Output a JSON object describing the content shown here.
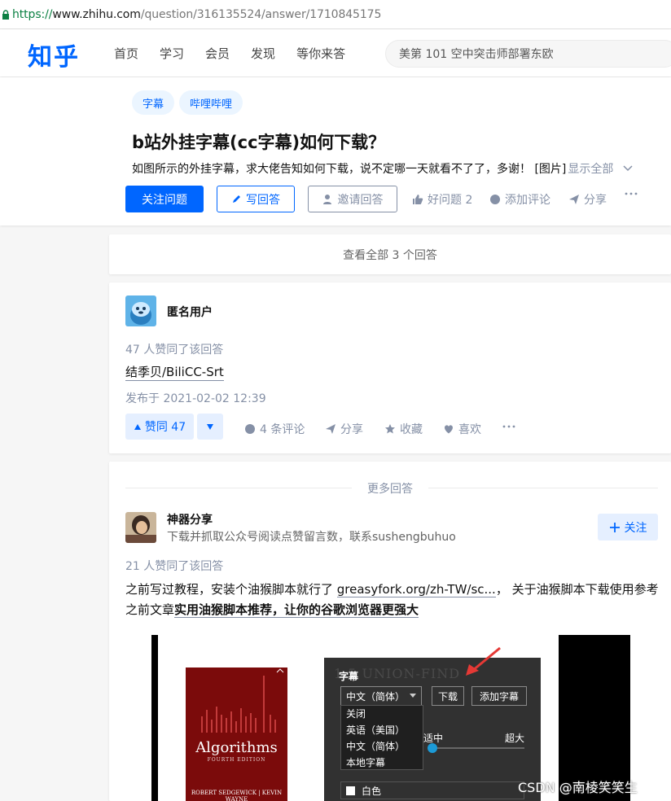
{
  "address_bar": {
    "scheme": "https://",
    "host": "www.zhihu.com",
    "path": "/question/316135524/answer/1710845175"
  },
  "header": {
    "logo": "知乎",
    "nav": [
      "首页",
      "学习",
      "会员",
      "发现",
      "等你来答"
    ],
    "search_placeholder": "美第 101 空中突击师部署东欧"
  },
  "question": {
    "tags": [
      "字幕",
      "哔哩哔哩"
    ],
    "title": "b站外挂字幕(cc字幕)如何下载？",
    "description": "如图所示的外挂字幕，求大佬告知如何下载，说不定哪一天就看不了了，多谢！ [图片]",
    "show_all": "显示全部",
    "follow_btn": "关注问题",
    "write_btn": "写回答",
    "invite_btn": "邀请回答",
    "good_question": "好问题 2",
    "add_comment": "添加评论",
    "share": "分享"
  },
  "view_all": "查看全部 3 个回答",
  "answer1": {
    "author": "匿名用户",
    "likes": "47 人赞同了该回答",
    "link": "结季贝/BiliCC-Srt",
    "published": "发布于 2021-02-02 12:39",
    "vote": "赞同 47",
    "comments": "4 条评论",
    "share": "分享",
    "favorite": "收藏",
    "like": "喜欢"
  },
  "more_answers": "更多回答",
  "answer2": {
    "author": "神器分享",
    "bio": "下载并抓取公众号阅读点赞留言数，联系sushengbuhuo",
    "follow": "关注",
    "likes": "21 人赞同了该回答",
    "text_part1": "之前写过教程，安装个油猴脚本就行了 ",
    "text_link": "greasyfork.org/zh-TW/sc...",
    "text_part2": "， 关于油猴脚本下载使用参考之前文章",
    "text_bold": "实用油猴脚本推荐，让你的谷歌浏览器更强大"
  },
  "screenshot": {
    "book_title": "Algorithms",
    "book_sub": "FOURTH EDITION",
    "book_authors": "ROBERT SEDGEWICK  |  KEVIN WAYNE",
    "ghost_text": "1.5  UNION-FIND",
    "panel_title": "字幕",
    "select_value": "中文（简体）",
    "download_btn": "下载",
    "add_sub_btn": "添加字幕",
    "options": [
      "关闭",
      "英语（美国）",
      "中文（简体）",
      "本地字幕"
    ],
    "size_mid": "适中",
    "size_max": "超大",
    "color_label": "白色"
  },
  "watermark": "CSDN @南棱笑笑生",
  "colors": {
    "brand": "#0066ff",
    "muted": "#8590a6"
  }
}
